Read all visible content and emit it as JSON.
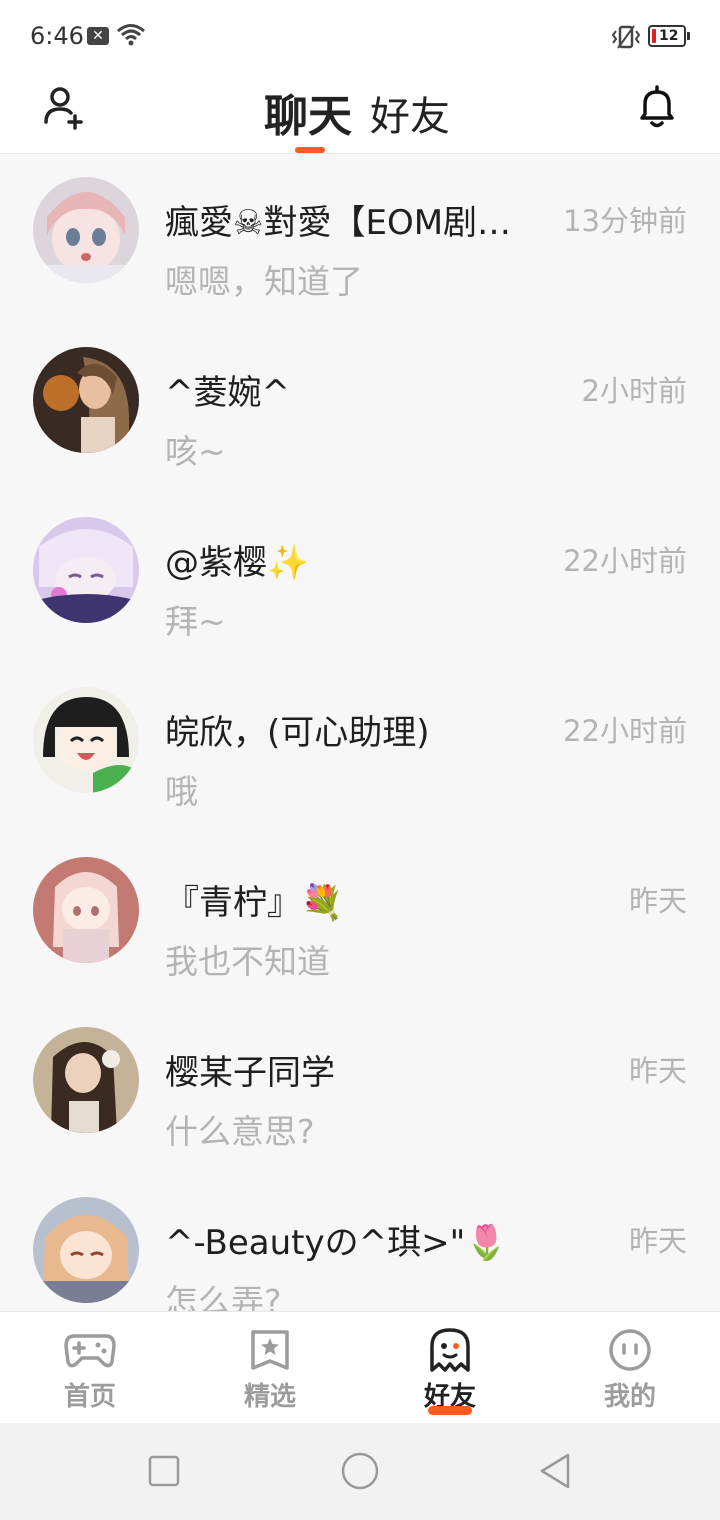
{
  "status_bar": {
    "time": "6:46",
    "battery_level": "12",
    "battery_color": "#e02020"
  },
  "header": {
    "tab_chat": "聊天",
    "tab_friends": "好友",
    "accent_color": "#ff5a1f",
    "left_icon": "add-friend-icon",
    "right_icon": "bell-icon"
  },
  "chats": [
    {
      "name": "瘋愛☠對愛【EOM剧…",
      "time": "13分钟前",
      "message": "嗯嗯，知道了"
    },
    {
      "name": "^菱婉^",
      "time": "2小时前",
      "message": "咳~"
    },
    {
      "name": "@紫樱✨",
      "time": "22小时前",
      "message": "拜~"
    },
    {
      "name": "皖欣，(可心助理)",
      "time": "22小时前",
      "message": "哦"
    },
    {
      "name": "『青柠』💐",
      "time": "昨天",
      "message": "我也不知道"
    },
    {
      "name": "樱某子同学",
      "time": "昨天",
      "message": "什么意思?"
    },
    {
      "name": "^-Beautyの^琪>\"🌷",
      "time": "昨天",
      "message": "怎么弄?"
    }
  ],
  "bottom_nav": {
    "items": [
      {
        "label": "首页",
        "icon": "gamepad-icon"
      },
      {
        "label": "精选",
        "icon": "star-icon"
      },
      {
        "label": "好友",
        "icon": "ghost-icon",
        "active": true
      },
      {
        "label": "我的",
        "icon": "smiley-icon"
      }
    ]
  },
  "system_nav": {
    "icons": [
      "square-icon",
      "circle-icon",
      "back-triangle-icon"
    ]
  }
}
